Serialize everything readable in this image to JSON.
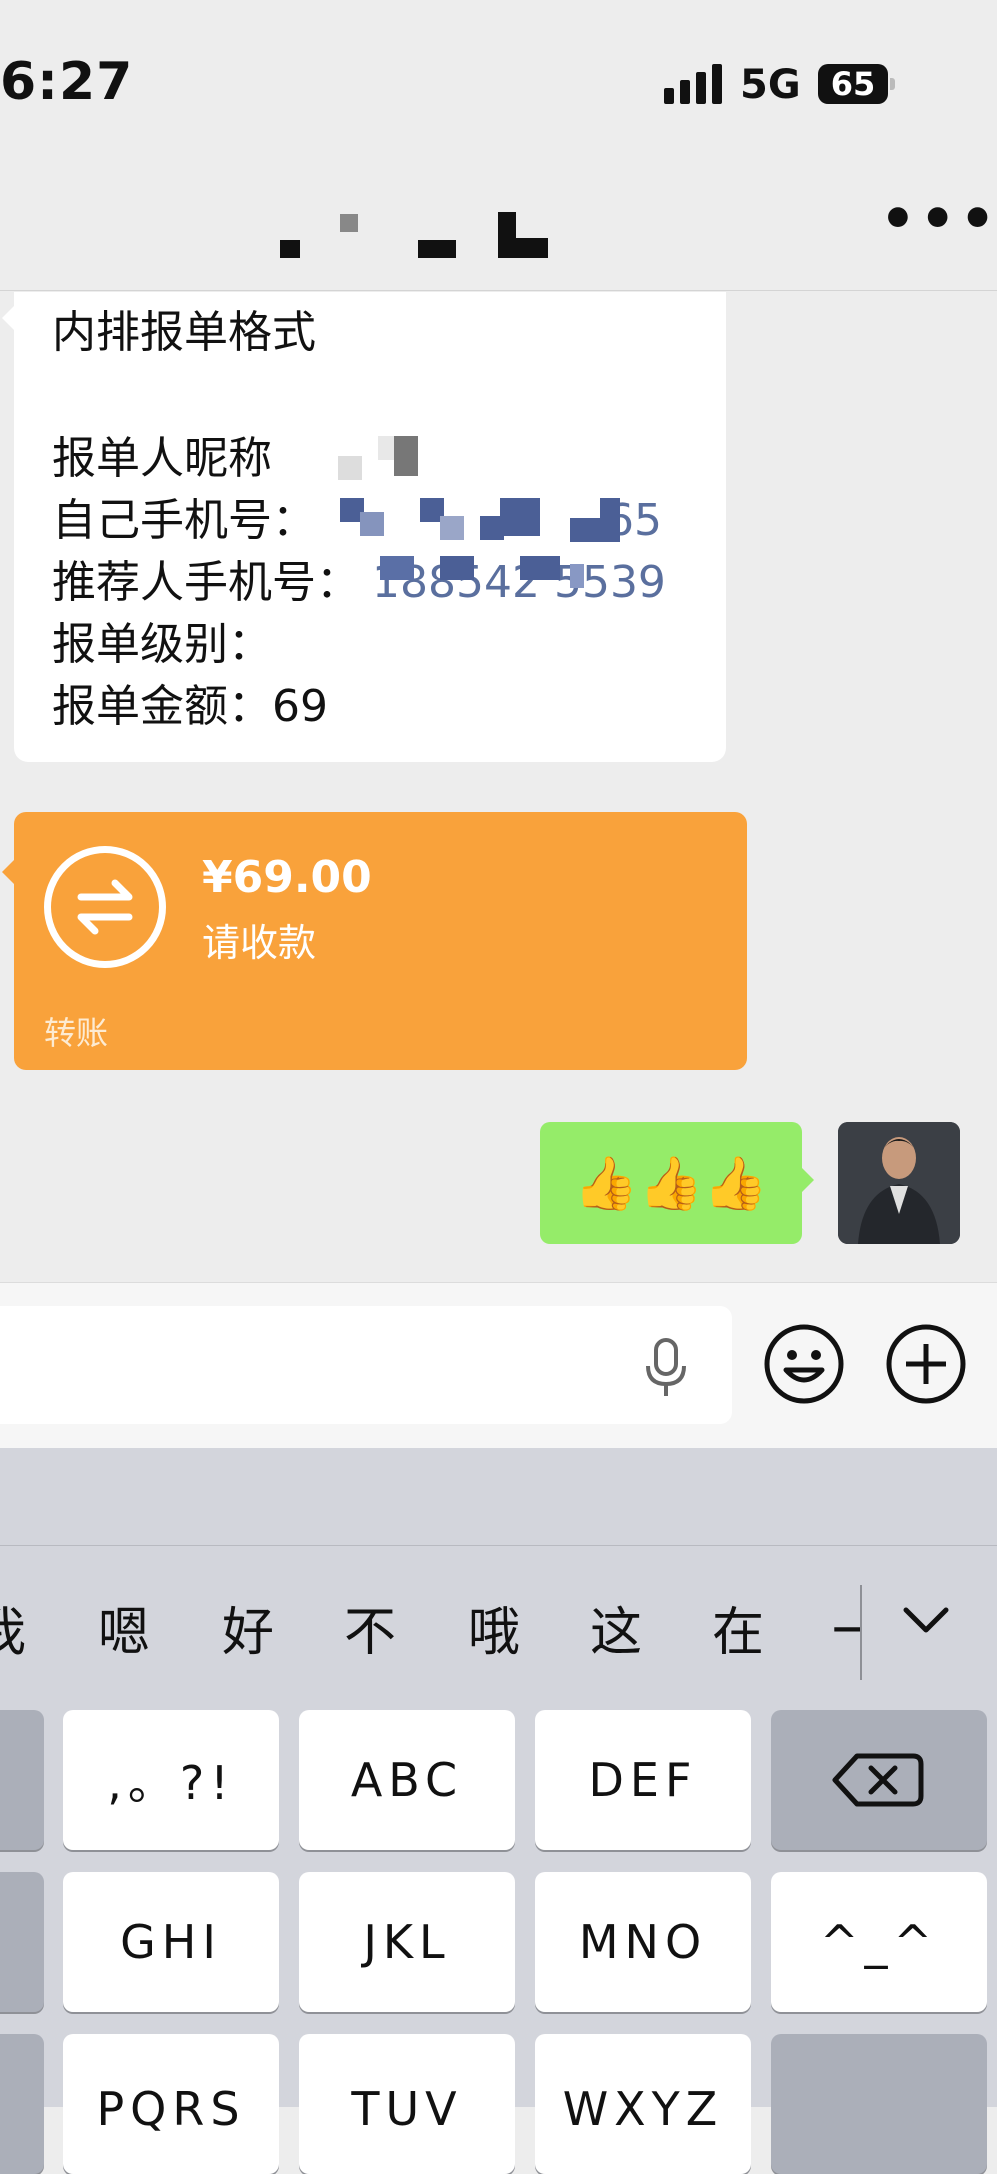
{
  "status": {
    "time": "6:27",
    "network": "5G",
    "battery": "65"
  },
  "header": {
    "more": "•••"
  },
  "message": {
    "line1": "内排报单格式",
    "line2_label": "报单人昵称",
    "line3_label": "自己手机号：",
    "line3_value": "65",
    "line4_label": "推荐人手机号：",
    "line4_value": "188542 5539",
    "line5_label": "报单级别：",
    "line6_label": "报单金额：",
    "line6_value": "69"
  },
  "transfer": {
    "amount": "¥69.00",
    "status": "请收款",
    "label": "转账"
  },
  "reply": {
    "emoji": "👍👍👍"
  },
  "keyboard": {
    "candidates": [
      "我",
      "嗯",
      "好",
      "不",
      "哦",
      "这",
      "在",
      "一"
    ],
    "row1": [
      ",。?!",
      "ABC",
      "DEF"
    ],
    "row2": [
      "GHI",
      "JKL",
      "MNO",
      "^_^"
    ],
    "row3": [
      "PQRS",
      "TUV",
      "WXYZ"
    ]
  }
}
